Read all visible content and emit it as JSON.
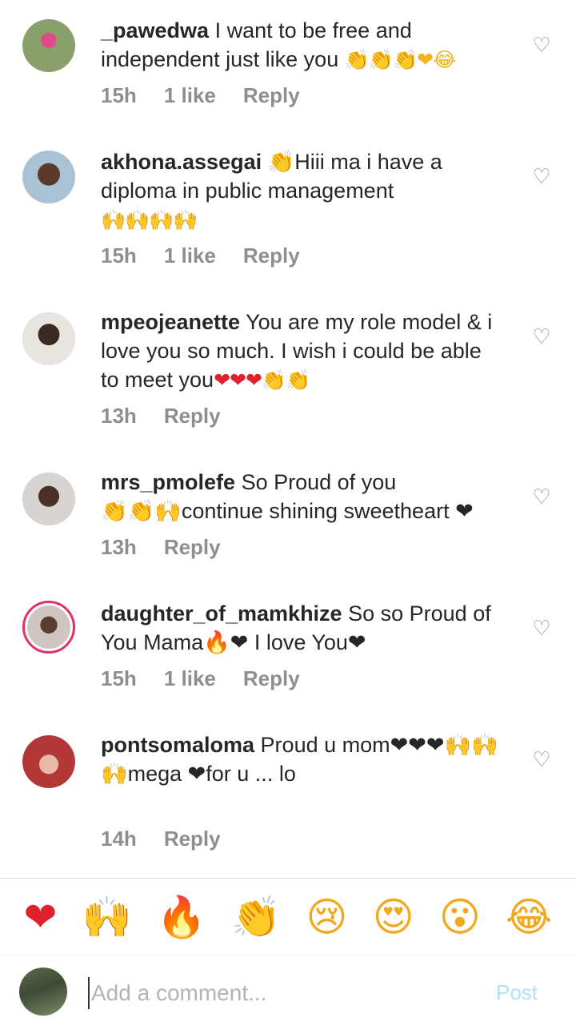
{
  "comments": [
    {
      "username": "_pawedwa",
      "text": "I want to be free and independent just like you",
      "emoji": "👏👏👏❤😂",
      "time": "15h",
      "likes": "1 like",
      "reply": "Reply",
      "avatar_color": "#7a8a5a"
    },
    {
      "username": "akhona.assegai",
      "text": "👏Hiii ma i have a diploma in public management",
      "emoji": "🙌🙌🙌🙌",
      "time": "15h",
      "likes": "1 like",
      "reply": "Reply",
      "avatar_color": "#b8c3c8"
    },
    {
      "username": "mpeojeanette",
      "text": "You are my role model & i love you so much. I wish i could be able to meet you",
      "emoji": "❤❤❤👏👏",
      "time": "13h",
      "likes": "",
      "reply": "Reply",
      "avatar_color": "#d9d4cf"
    },
    {
      "username": "mrs_pmolefe",
      "text": "So Proud of you",
      "emoji": "👏👏🙌continue shining sweetheart ❤",
      "time": "13h",
      "likes": "",
      "reply": "Reply",
      "avatar_color": "#cfc9c6"
    },
    {
      "username": "daughter_of_mamkhize",
      "text": "So so Proud of You Mama🔥❤ I love You❤",
      "emoji": "",
      "time": "15h",
      "likes": "1 like",
      "reply": "Reply",
      "avatar_color": "#c4b7b4"
    },
    {
      "username": "pontsomaloma",
      "text": "Proud u mom❤❤❤🙌🙌🙌mega ❤for u ... lo",
      "emoji": "",
      "time": "14h",
      "likes": "",
      "reply": "Reply",
      "avatar_color": "#b23838"
    }
  ],
  "reactions": [
    "❤",
    "🙌",
    "🔥",
    "👏",
    "😢",
    "😍",
    "😮",
    "😂"
  ],
  "composer": {
    "placeholder": "Add a comment...",
    "post_label": "Post"
  },
  "icons": {
    "like": "heart-outline-icon"
  },
  "colors": {
    "meta": "#8e8e8e",
    "post_disabled": "#b2dffc",
    "heart_red": "#e0202b",
    "story_ring": "#e1306c"
  }
}
